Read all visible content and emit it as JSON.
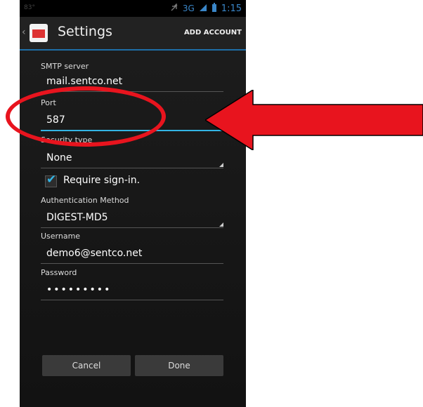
{
  "status_bar": {
    "left_text": "83°",
    "network_label": "3G",
    "time": "1:15"
  },
  "action_bar": {
    "title": "Settings",
    "add_account": "ADD ACCOUNT"
  },
  "form": {
    "smtp_server": {
      "label": "SMTP server",
      "value": "mail.sentco.net"
    },
    "port": {
      "label": "Port",
      "value": "587"
    },
    "security_type": {
      "label": "Security type",
      "value": "None"
    },
    "require_signin": {
      "label": "Require sign-in.",
      "checked": true
    },
    "auth_method": {
      "label": "Authentication Method",
      "value": "DIGEST-MD5"
    },
    "username": {
      "label": "Username",
      "value": "demo6@sentco.net"
    },
    "password": {
      "label": "Password",
      "value": "•••••••••"
    }
  },
  "buttons": {
    "cancel": "Cancel",
    "done": "Done"
  },
  "colors": {
    "accent": "#33b5e5",
    "annotation": "#e8141e",
    "background": "#141414"
  },
  "icons": [
    "app-email-icon",
    "up-caret-icon",
    "mute-icon",
    "signal-icon",
    "battery-icon",
    "checkmark-icon",
    "spinner-triangle-icon"
  ]
}
